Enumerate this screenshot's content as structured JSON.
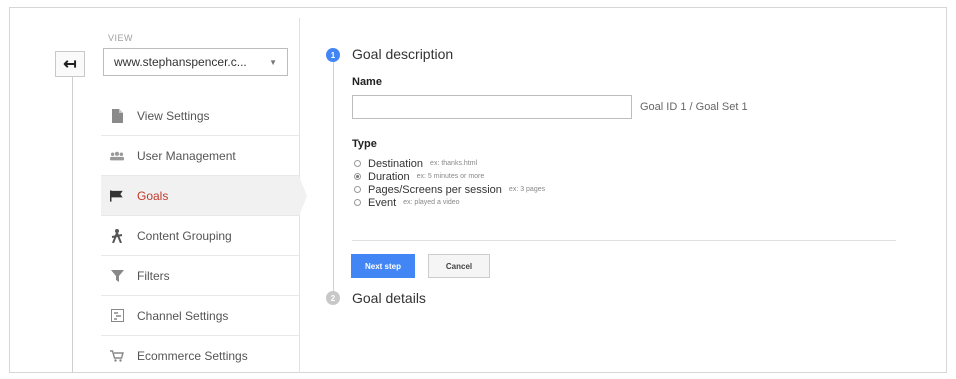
{
  "sidebar": {
    "back_icon": "back-arrow-icon",
    "view_label": "VIEW",
    "view_selected": "www.stephanspencer.c...",
    "items": [
      {
        "label": "View Settings",
        "icon": "document-icon"
      },
      {
        "label": "User Management",
        "icon": "users-icon"
      },
      {
        "label": "Goals",
        "icon": "flag-icon",
        "active": true
      },
      {
        "label": "Content Grouping",
        "icon": "person-walking-icon"
      },
      {
        "label": "Filters",
        "icon": "filter-icon"
      },
      {
        "label": "Channel Settings",
        "icon": "channel-icon"
      },
      {
        "label": "Ecommerce Settings",
        "icon": "cart-icon"
      }
    ]
  },
  "steps": [
    {
      "number": "1",
      "title": "Goal description"
    },
    {
      "number": "2",
      "title": "Goal details"
    }
  ],
  "form": {
    "name_label": "Name",
    "name_value": "",
    "goal_id": "Goal ID 1 / Goal Set 1",
    "type_label": "Type",
    "types": [
      {
        "label": "Destination",
        "example": "ex: thanks.html",
        "selected": false
      },
      {
        "label": "Duration",
        "example": "ex: 5 minutes or more",
        "selected": true
      },
      {
        "label": "Pages/Screens per session",
        "example": "ex: 3 pages",
        "selected": false
      },
      {
        "label": "Event",
        "example": "ex: played a video",
        "selected": false
      }
    ],
    "next_label": "Next step",
    "cancel_label": "Cancel"
  },
  "colors": {
    "accent": "#4285f4",
    "active_text": "#c0392b"
  }
}
